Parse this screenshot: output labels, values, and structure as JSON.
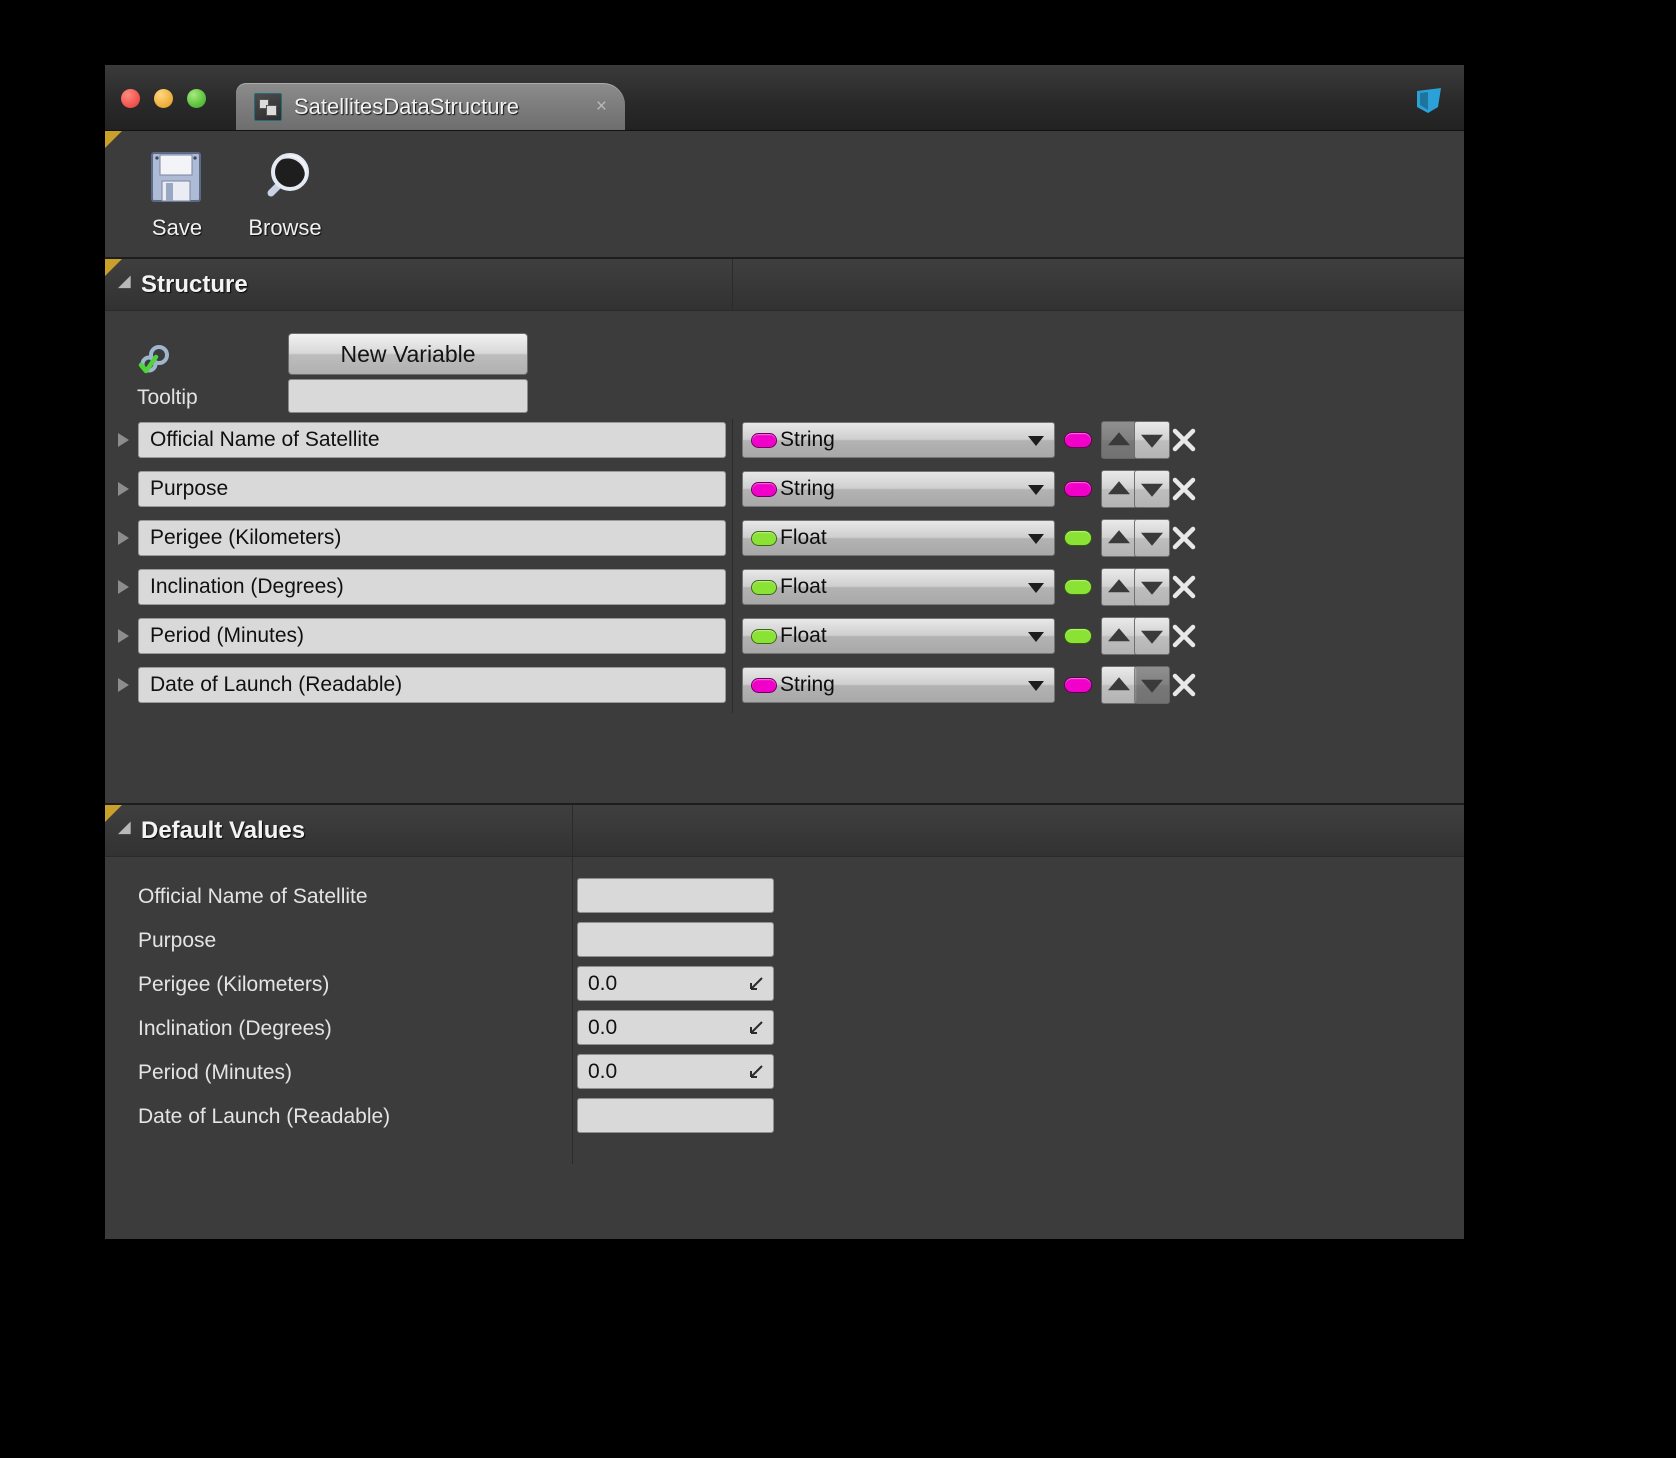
{
  "window": {
    "traffic_lights": [
      "close",
      "minimize",
      "zoom"
    ],
    "tab": {
      "title": "SatellitesDataStructure",
      "icon": "blueprint-struct-icon",
      "close_label": "×"
    },
    "logo_icon": "unreal-engine-logo"
  },
  "toolbar": {
    "buttons": [
      {
        "label": "Save",
        "icon": "floppy-disk-icon"
      },
      {
        "label": "Browse",
        "icon": "magnifier-icon"
      }
    ]
  },
  "structure": {
    "header": "Structure",
    "gear_icon": "gear-check-icon",
    "new_variable_label": "New Variable",
    "tooltip_label": "Tooltip",
    "tooltip_value": "",
    "tooltip_placeholder": "",
    "rows": [
      {
        "name": "Official Name of Satellite",
        "type": "String",
        "color": "#f000c8",
        "up_enabled": false,
        "down_enabled": true
      },
      {
        "name": "Purpose",
        "type": "String",
        "color": "#f000c8",
        "up_enabled": true,
        "down_enabled": true
      },
      {
        "name": "Perigee (Kilometers)",
        "type": "Float",
        "color": "#8ae234",
        "up_enabled": true,
        "down_enabled": true
      },
      {
        "name": "Inclination (Degrees)",
        "type": "Float",
        "color": "#8ae234",
        "up_enabled": true,
        "down_enabled": true
      },
      {
        "name": "Period (Minutes)",
        "type": "Float",
        "color": "#8ae234",
        "up_enabled": true,
        "down_enabled": true
      },
      {
        "name": "Date of Launch (Readable)",
        "type": "String",
        "color": "#f000c8",
        "up_enabled": true,
        "down_enabled": false
      }
    ]
  },
  "default_values": {
    "header": "Default Values",
    "rows": [
      {
        "label": "Official Name of Satellite",
        "value": "",
        "kind": "text"
      },
      {
        "label": "Purpose",
        "value": "",
        "kind": "text"
      },
      {
        "label": "Perigee (Kilometers)",
        "value": "0.0",
        "kind": "number"
      },
      {
        "label": "Inclination (Degrees)",
        "value": "0.0",
        "kind": "number"
      },
      {
        "label": "Period (Minutes)",
        "value": "0.0",
        "kind": "number"
      },
      {
        "label": "Date of Launch (Readable)",
        "value": "",
        "kind": "text"
      }
    ]
  }
}
